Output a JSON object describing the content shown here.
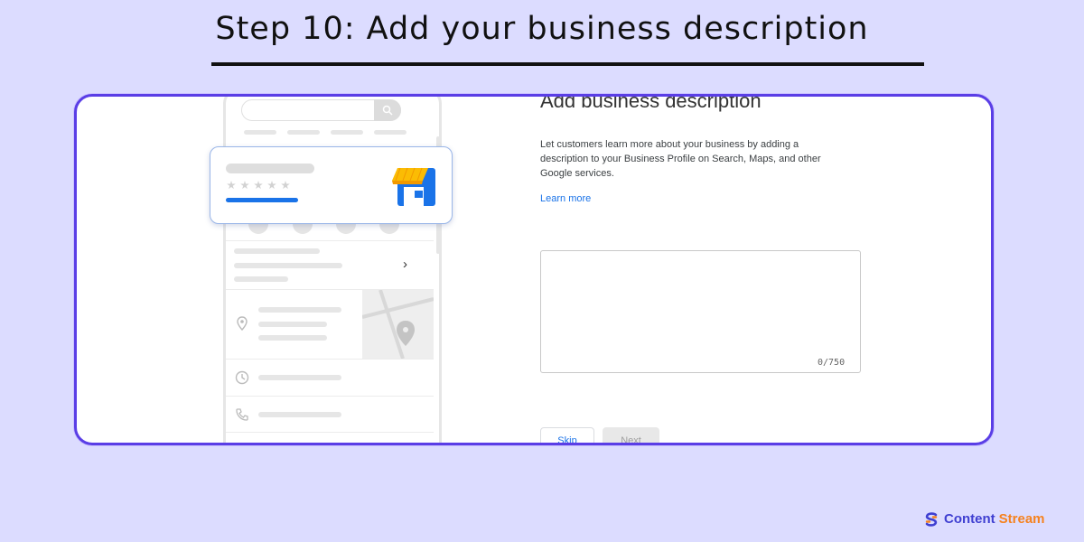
{
  "page": {
    "heading": "Step 10: Add your business description"
  },
  "form": {
    "title": "Add business description",
    "description": "Let customers learn more about your business by adding a description to your Business Profile on Search, Maps, and other Google services.",
    "learn_more": "Learn more",
    "textarea_value": "",
    "char_counter": "0/750",
    "skip_label": "Skip",
    "next_label": "Next"
  },
  "mockup": {
    "biz_card": {
      "stars_shown": 5
    }
  },
  "brand": {
    "word1": "Content",
    "word2": "Stream"
  },
  "colors": {
    "background": "#dcdcff",
    "card_border": "#5a3ee6",
    "link": "#1a73e8",
    "brand_blue": "#3f3fd1",
    "brand_orange": "#f5821f",
    "store_yellow": "#fbbc04",
    "store_blue": "#1a73e8"
  },
  "icons": [
    "search-icon",
    "chevron-right-icon",
    "location-pin-icon",
    "clock-icon",
    "phone-icon",
    "storefront-icon",
    "brand-logo-icon"
  ]
}
